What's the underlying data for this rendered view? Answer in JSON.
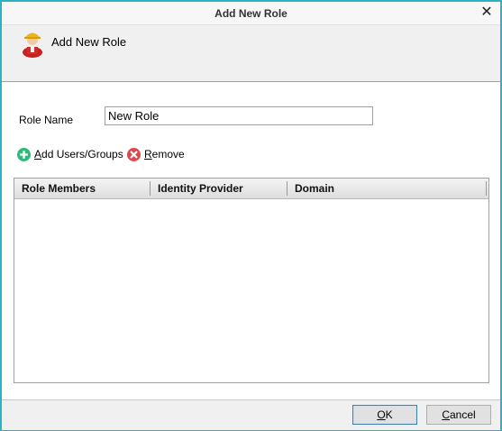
{
  "window": {
    "title": "Add New Role",
    "close_glyph": "✕"
  },
  "header": {
    "heading": "Add New Role",
    "icon": "user-role-icon"
  },
  "form": {
    "role_name_label": "Role Name",
    "role_name_value": "New Role"
  },
  "actions": {
    "add_accel": "A",
    "add_rest": "dd Users/Groups",
    "add_icon": "plus-circle-icon",
    "remove_accel": "R",
    "remove_rest": "emove",
    "remove_icon": "x-circle-icon"
  },
  "grid": {
    "columns": [
      "Role Members",
      "Identity Provider",
      "Domain"
    ],
    "rows": []
  },
  "buttons": {
    "ok_accel": "O",
    "ok_rest": "K",
    "cancel_accel": "C",
    "cancel_rest": "ancel"
  },
  "colors": {
    "window_border": "#2ab3c2",
    "add_icon": "#2dbb7a",
    "remove_icon": "#e2464c"
  }
}
